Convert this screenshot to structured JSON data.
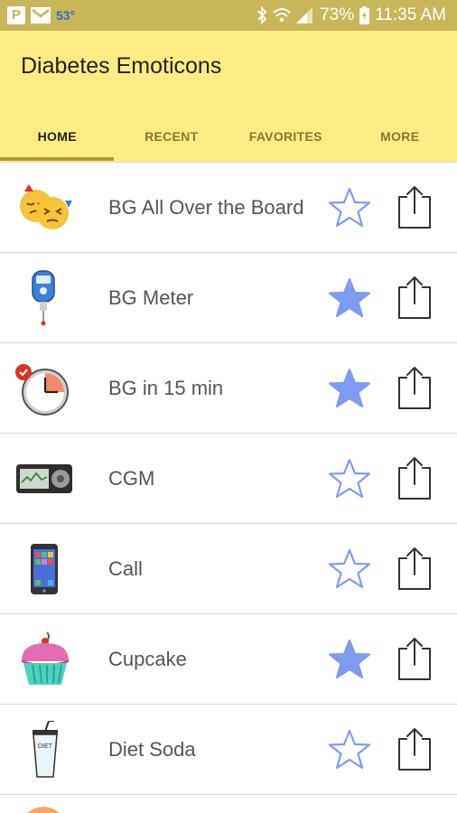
{
  "status_bar": {
    "parking_icon": "P",
    "temperature": "53°",
    "battery": "73%",
    "time": "11:35 AM"
  },
  "app": {
    "title": "Diabetes Emoticons",
    "tabs": [
      {
        "label": "HOME",
        "active": true
      },
      {
        "label": "RECENT",
        "active": false
      },
      {
        "label": "FAVORITES",
        "active": false
      },
      {
        "label": "MORE",
        "active": false
      }
    ]
  },
  "colors": {
    "app_bar": "#fdec84",
    "status_bar": "#c9b65a",
    "star_accent": "#7e9cf0",
    "tab_indicator": "#b19a2c"
  },
  "emoticons": [
    {
      "name": "BG All Over the Board",
      "favorite": false,
      "icon": "two-faces-icon"
    },
    {
      "name": "BG Meter",
      "favorite": true,
      "icon": "glucose-meter-icon"
    },
    {
      "name": "BG in 15 min",
      "favorite": true,
      "icon": "clock-icon"
    },
    {
      "name": "CGM",
      "favorite": false,
      "icon": "cgm-device-icon"
    },
    {
      "name": "Call",
      "favorite": false,
      "icon": "phone-icon"
    },
    {
      "name": "Cupcake",
      "favorite": true,
      "icon": "cupcake-icon"
    },
    {
      "name": "Diet Soda",
      "favorite": false,
      "icon": "diet-soda-icon"
    }
  ]
}
